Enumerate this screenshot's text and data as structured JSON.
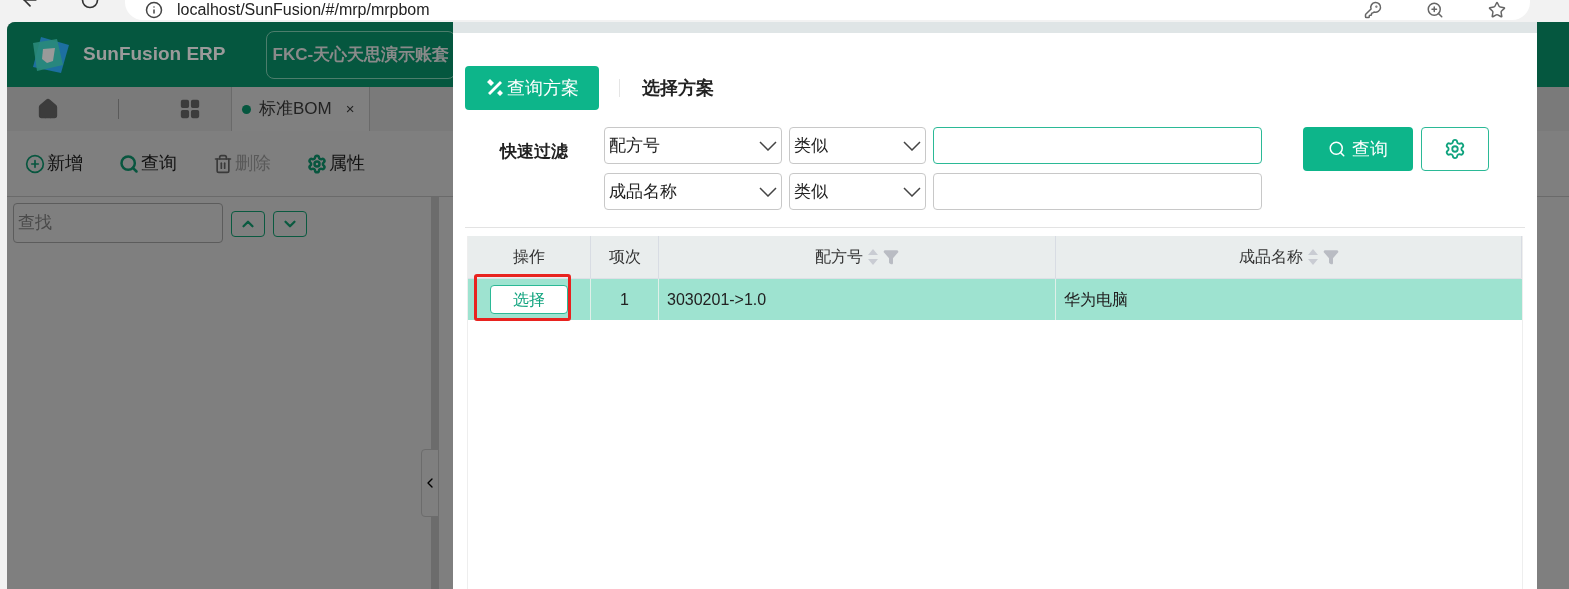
{
  "browser": {
    "url": "localhost/SunFusion/#/mrp/mrpbom"
  },
  "app": {
    "brand": "SunFusion ERP",
    "account": "FKC-天心天思演示账套",
    "open_tab": {
      "label": "标准BOM",
      "close": "×",
      "selected": true
    },
    "toolbar": [
      {
        "kind": "plus",
        "label": "新增",
        "disabled": false
      },
      {
        "kind": "search",
        "label": "查询",
        "disabled": false
      },
      {
        "kind": "trash",
        "label": "删除",
        "disabled": true
      },
      {
        "kind": "gear",
        "label": "属性",
        "disabled": false
      }
    ],
    "find": {
      "placeholder": "查找"
    }
  },
  "dialog": {
    "tabs": [
      {
        "label": "查询方案",
        "selected": true
      },
      {
        "label": "选择方案",
        "selected": false
      }
    ],
    "quick_filter": {
      "label": "快速过滤",
      "rows": [
        {
          "field": "配方号",
          "operator": "类似",
          "focused": true
        },
        {
          "field": "成品名称",
          "operator": "类似",
          "focused": false
        }
      ]
    },
    "query_button": "查询",
    "table": {
      "columns": [
        {
          "label": "操作",
          "sortable": false
        },
        {
          "label": "项次",
          "sortable": false
        },
        {
          "label": "配方号",
          "sortable": true
        },
        {
          "label": "成品名称",
          "sortable": true
        }
      ],
      "rows": [
        {
          "action": "选择",
          "index": "1",
          "formula_no": "3030201->1.0",
          "product_name": "华为电脑",
          "selected": true,
          "marked": true
        }
      ]
    }
  }
}
